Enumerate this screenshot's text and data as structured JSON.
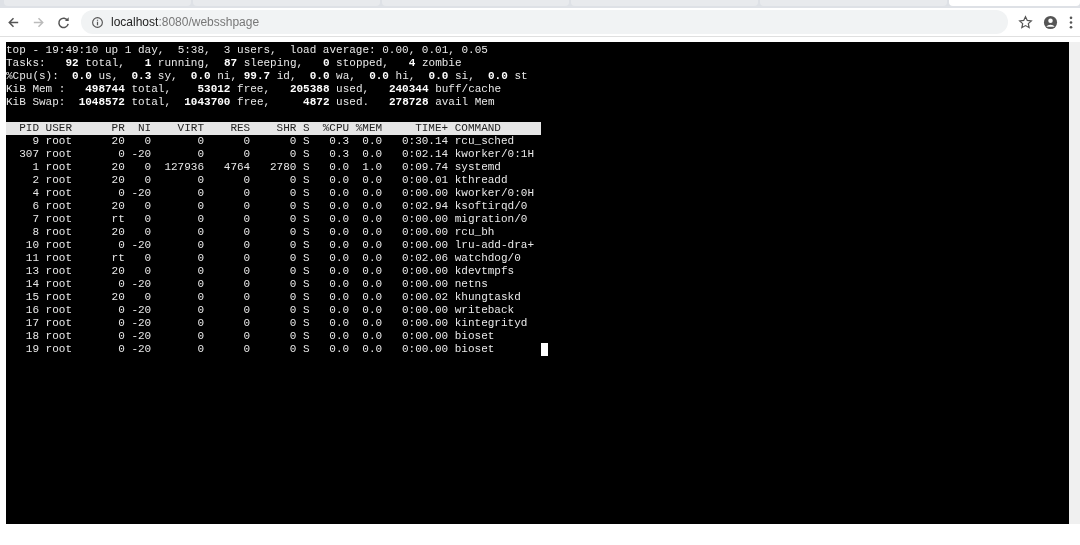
{
  "browser": {
    "tabs": [
      {
        "selected": false
      },
      {
        "selected": false
      },
      {
        "selected": false
      },
      {
        "selected": false
      },
      {
        "selected": false
      },
      {
        "selected": true
      }
    ],
    "url_host": "localhost",
    "url_path": ":8080/websshpage"
  },
  "terminal": {
    "summary": [
      "top - 19:49:10 up 1 day,  5:38,  3 users,  load average: 0.00, 0.01, 0.05",
      "Tasks:   **92** total,   **1** running,  **87** sleeping,   **0** stopped,   **4** zombie",
      "%Cpu(s):  **0.0** us,  **0.3** sy,  **0.0** ni, **99.7** id,  **0.0** wa,  **0.0** hi,  **0.0** si,  **0.0** st",
      "KiB Mem :   **498744** total,    **53012** free,   **205388** used,   **240344** buff/cache",
      "KiB Swap:  **1048572** total,  **1043700** free,     **4872** used.   **278728** avail Mem"
    ],
    "columns": [
      "PID",
      "USER",
      "PR",
      "NI",
      "VIRT",
      "RES",
      "SHR",
      "S",
      "%CPU",
      "%MEM",
      "TIME+",
      "COMMAND"
    ],
    "rows": [
      [
        "9",
        "root",
        "20",
        "0",
        "0",
        "0",
        "0",
        "S",
        "0.3",
        "0.0",
        "0:30.14",
        "rcu_sched"
      ],
      [
        "307",
        "root",
        "0",
        "-20",
        "0",
        "0",
        "0",
        "S",
        "0.3",
        "0.0",
        "0:02.14",
        "kworker/0:1H"
      ],
      [
        "1",
        "root",
        "20",
        "0",
        "127936",
        "4764",
        "2780",
        "S",
        "0.0",
        "1.0",
        "0:09.74",
        "systemd"
      ],
      [
        "2",
        "root",
        "20",
        "0",
        "0",
        "0",
        "0",
        "S",
        "0.0",
        "0.0",
        "0:00.01",
        "kthreadd"
      ],
      [
        "4",
        "root",
        "0",
        "-20",
        "0",
        "0",
        "0",
        "S",
        "0.0",
        "0.0",
        "0:00.00",
        "kworker/0:0H"
      ],
      [
        "6",
        "root",
        "20",
        "0",
        "0",
        "0",
        "0",
        "S",
        "0.0",
        "0.0",
        "0:02.94",
        "ksoftirqd/0"
      ],
      [
        "7",
        "root",
        "rt",
        "0",
        "0",
        "0",
        "0",
        "S",
        "0.0",
        "0.0",
        "0:00.00",
        "migration/0"
      ],
      [
        "8",
        "root",
        "20",
        "0",
        "0",
        "0",
        "0",
        "S",
        "0.0",
        "0.0",
        "0:00.00",
        "rcu_bh"
      ],
      [
        "10",
        "root",
        "0",
        "-20",
        "0",
        "0",
        "0",
        "S",
        "0.0",
        "0.0",
        "0:00.00",
        "lru-add-dra+"
      ],
      [
        "11",
        "root",
        "rt",
        "0",
        "0",
        "0",
        "0",
        "S",
        "0.0",
        "0.0",
        "0:02.06",
        "watchdog/0"
      ],
      [
        "13",
        "root",
        "20",
        "0",
        "0",
        "0",
        "0",
        "S",
        "0.0",
        "0.0",
        "0:00.00",
        "kdevtmpfs"
      ],
      [
        "14",
        "root",
        "0",
        "-20",
        "0",
        "0",
        "0",
        "S",
        "0.0",
        "0.0",
        "0:00.00",
        "netns"
      ],
      [
        "15",
        "root",
        "20",
        "0",
        "0",
        "0",
        "0",
        "S",
        "0.0",
        "0.0",
        "0:00.02",
        "khungtaskd"
      ],
      [
        "16",
        "root",
        "0",
        "-20",
        "0",
        "0",
        "0",
        "S",
        "0.0",
        "0.0",
        "0:00.00",
        "writeback"
      ],
      [
        "17",
        "root",
        "0",
        "-20",
        "0",
        "0",
        "0",
        "S",
        "0.0",
        "0.0",
        "0:00.00",
        "kintegrityd"
      ],
      [
        "18",
        "root",
        "0",
        "-20",
        "0",
        "0",
        "0",
        "S",
        "0.0",
        "0.0",
        "0:00.00",
        "bioset"
      ],
      [
        "19",
        "root",
        "0",
        "-20",
        "0",
        "0",
        "0",
        "S",
        "0.0",
        "0.0",
        "0:00.00",
        "bioset"
      ]
    ]
  }
}
